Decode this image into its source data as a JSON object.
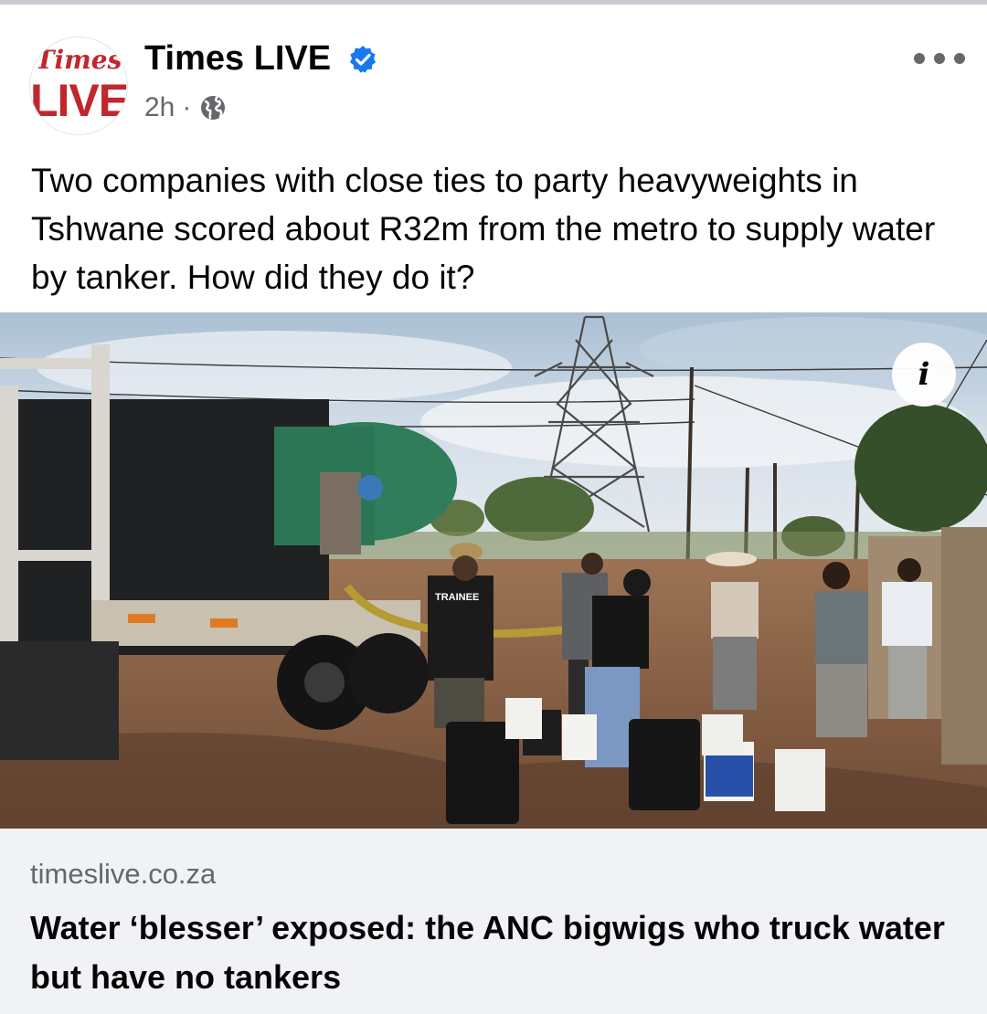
{
  "header": {
    "avatar_script": "Times",
    "avatar_live": "LIVE",
    "page_name": "Times LIVE",
    "time": "2h",
    "separator": "·",
    "privacy_icon": "globe-icon",
    "verified_icon": "verified-badge-icon",
    "more_icon": "more-options-icon"
  },
  "post": {
    "caption": "Two companies with close ties to party heavyweights in Tshwane scored about R32m from the metro to supply water by tanker. How did they do it?"
  },
  "image": {
    "shirt_text": "TRAINEE",
    "info_label": "i"
  },
  "link": {
    "domain": "timeslive.co.za",
    "headline": "Water ‘blesser’ exposed: the ANC bigwigs who truck water but have no tankers"
  },
  "colors": {
    "brand_red": "#c1272d",
    "verified_blue": "#1877f2",
    "secondary_text": "#65676b",
    "link_bg": "#f0f2f5"
  }
}
